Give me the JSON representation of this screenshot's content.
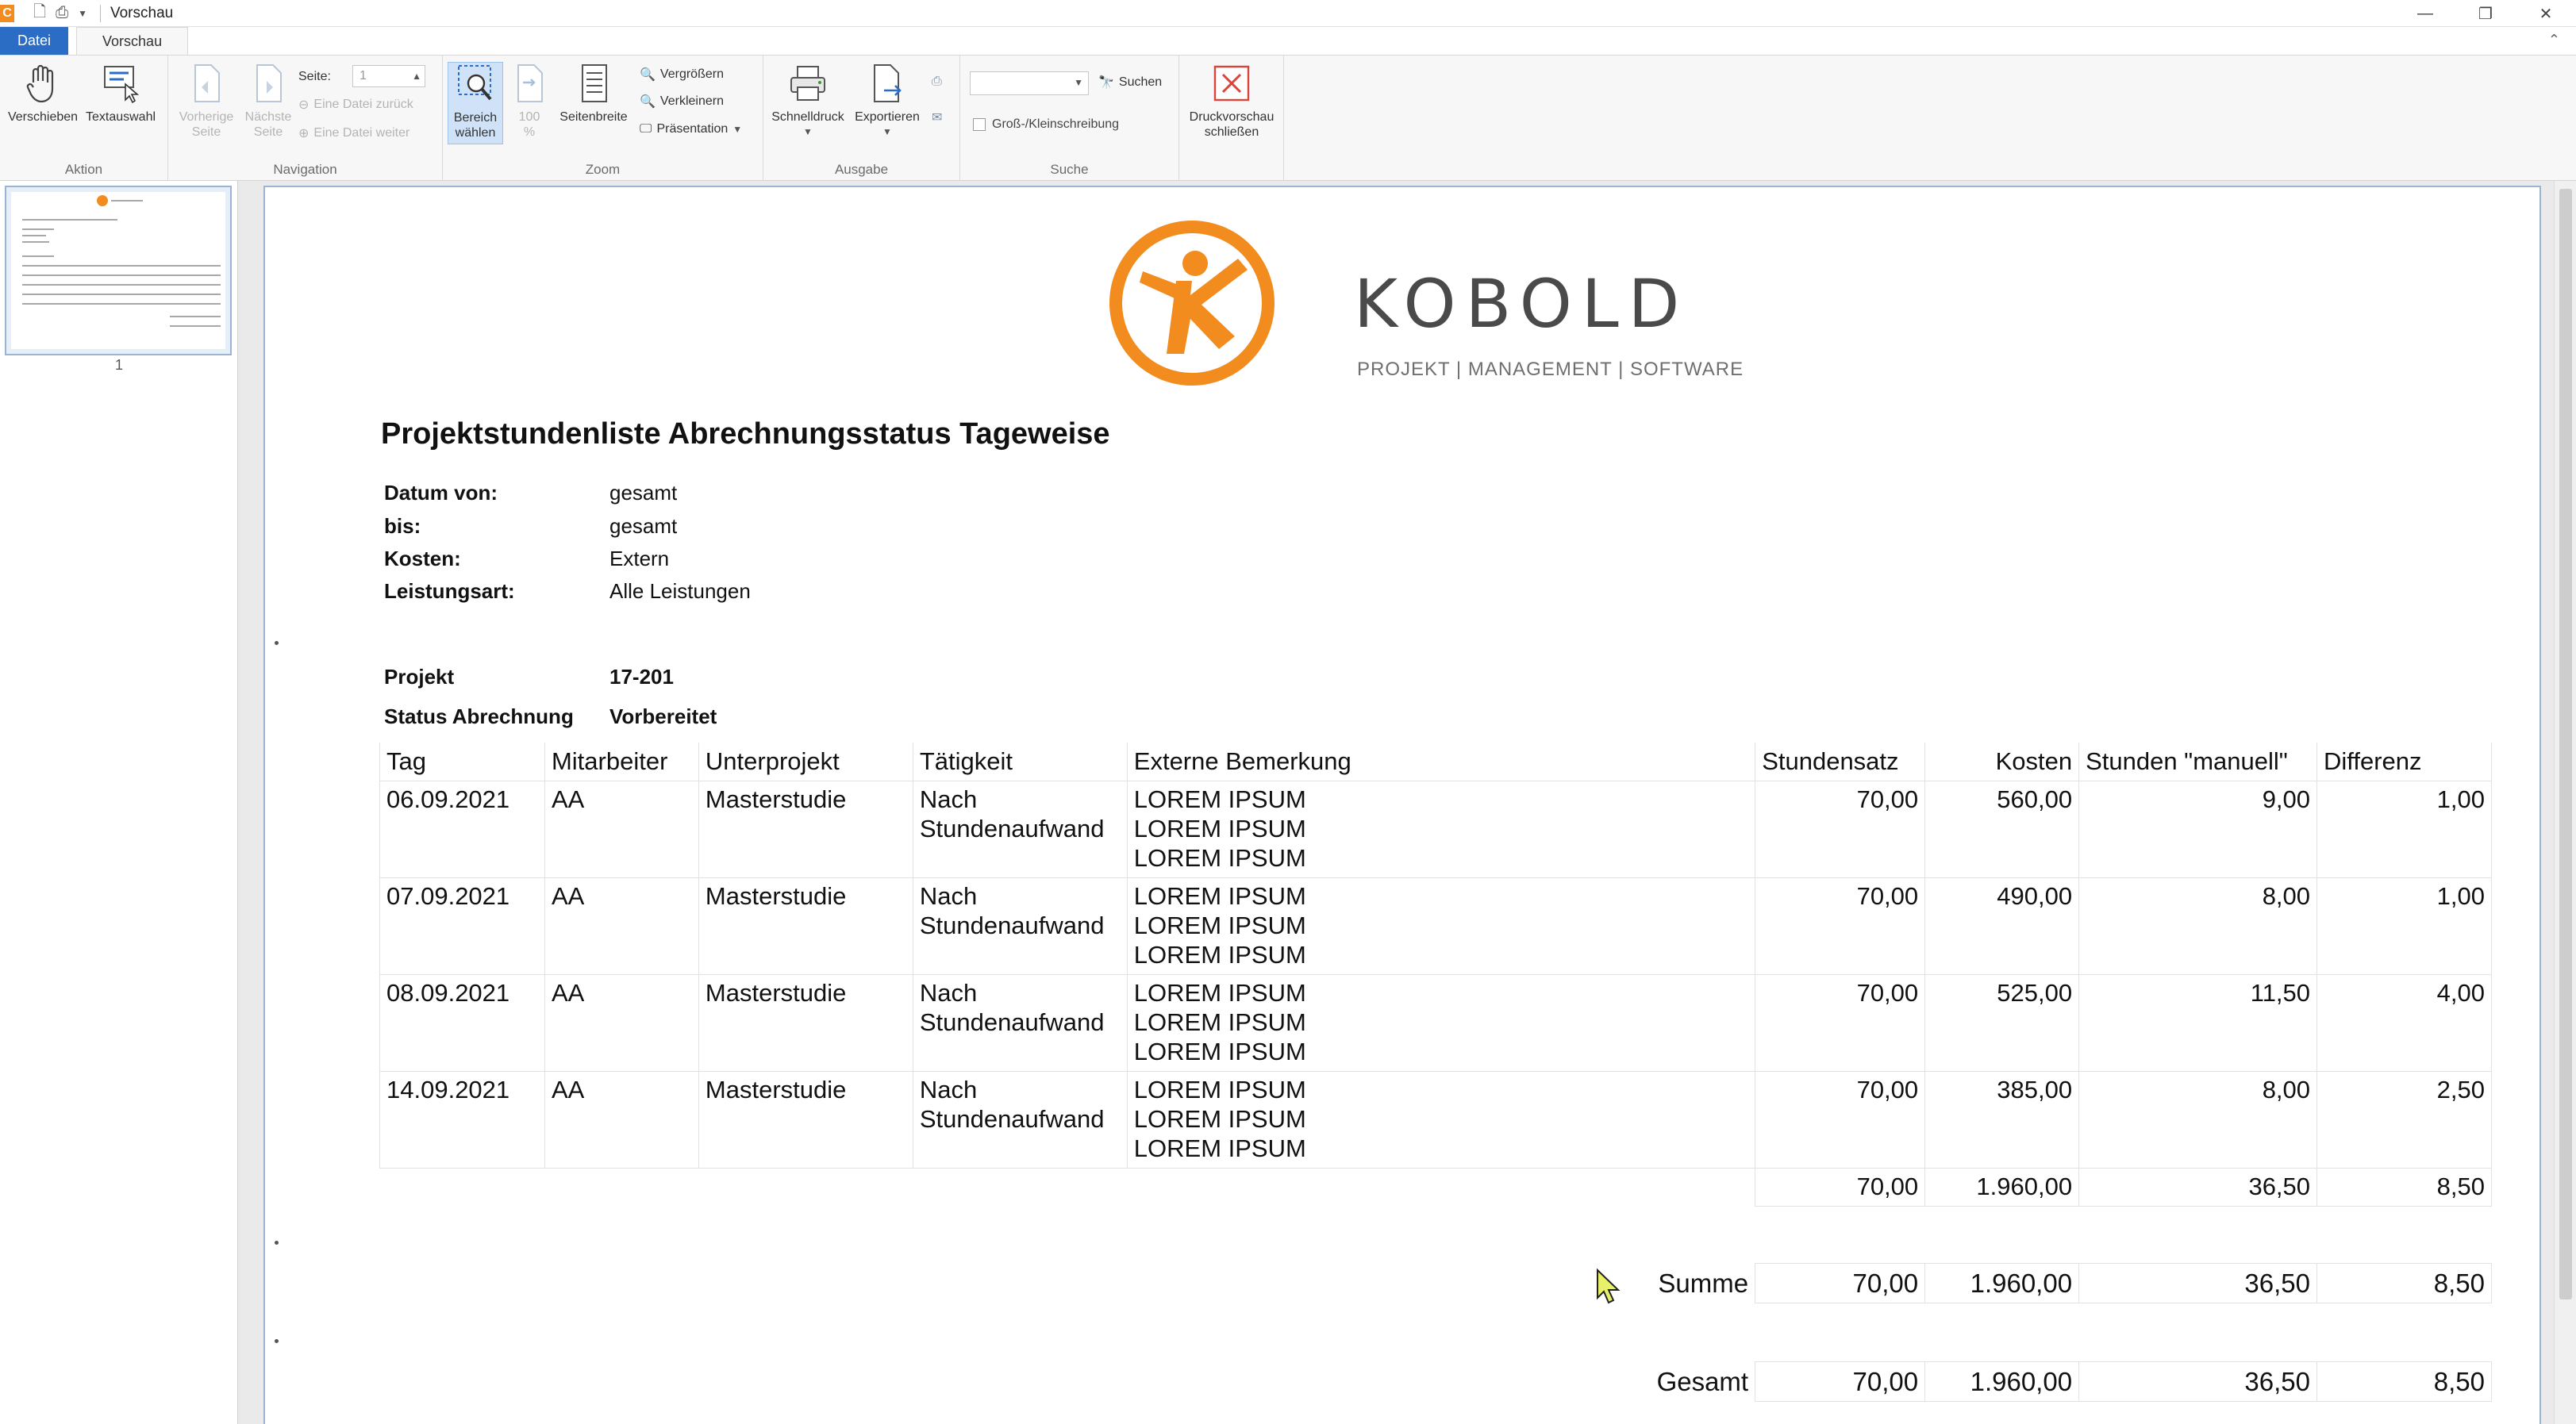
{
  "window": {
    "title": "Vorschau"
  },
  "tabs": {
    "file": "Datei",
    "preview": "Vorschau"
  },
  "ribbon": {
    "aktion": {
      "label": "Aktion",
      "move": "Verschieben",
      "textselect": "Textauswahl"
    },
    "navigation": {
      "label": "Navigation",
      "prev_1": "Vorherige",
      "prev_2": "Seite",
      "next_1": "Nächste",
      "next_2": "Seite",
      "page_label": "Seite:",
      "page_value": "1",
      "file_back": "Eine Datei zurück",
      "file_forward": "Eine Datei weiter"
    },
    "zoom": {
      "label": "Zoom",
      "area_1": "Bereich",
      "area_2": "wählen",
      "pct_1": "100",
      "pct_2": "%",
      "pagewidth": "Seitenbreite",
      "enlarge": "Vergrößern",
      "shrink": "Verkleinern",
      "presentation": "Präsentation"
    },
    "ausgabe": {
      "label": "Ausgabe",
      "quickprint": "Schnelldruck",
      "export": "Exportieren"
    },
    "suche": {
      "label": "Suche",
      "search": "Suchen",
      "casesensitive": "Groß-/Kleinschreibung"
    },
    "close": {
      "line1": "Druckvorschau",
      "line2": "schließen"
    }
  },
  "thumbnails": {
    "page_number": "1"
  },
  "report": {
    "logo": {
      "word": "KOBOLD",
      "tagline": "PROJEKT | MANAGEMENT | SOFTWARE"
    },
    "title": "Projektstundenliste Abrechnungsstatus Tageweise",
    "meta": [
      {
        "label": "Datum von:",
        "value": "gesamt"
      },
      {
        "label": "bis:",
        "value": "gesamt"
      },
      {
        "label": "Kosten:",
        "value": "Extern"
      },
      {
        "label": "Leistungsart:",
        "value": "Alle Leistungen"
      }
    ],
    "project": {
      "label": "Projekt",
      "value": "17-201"
    },
    "status": {
      "label": "Status Abrechnung",
      "value": "Vorbereitet"
    },
    "columns": [
      "Tag",
      "Mitarbeiter",
      "Unterprojekt",
      "Tätigkeit",
      "Externe Bemerkung",
      "Stundensatz",
      "Kosten",
      "Stunden \"manuell\"",
      "Differenz"
    ],
    "rows": [
      {
        "tag": "06.09.2021",
        "mitarbeiter": "AA",
        "unterprojekt": "Masterstudie",
        "taetigkeit_1": "Nach",
        "taetigkeit_2": "Stundenaufwand",
        "bemerkung_1": "LOREM IPSUM",
        "bemerkung_2": "LOREM IPSUM",
        "bemerkung_3": "LOREM IPSUM",
        "stundensatz": "70,00",
        "kosten": "560,00",
        "stunden": "9,00",
        "differenz": "1,00"
      },
      {
        "tag": "07.09.2021",
        "mitarbeiter": "AA",
        "unterprojekt": "Masterstudie",
        "taetigkeit_1": "Nach",
        "taetigkeit_2": "Stundenaufwand",
        "bemerkung_1": "LOREM IPSUM",
        "bemerkung_2": "LOREM IPSUM",
        "bemerkung_3": "LOREM IPSUM",
        "stundensatz": "70,00",
        "kosten": "490,00",
        "stunden": "8,00",
        "differenz": "1,00"
      },
      {
        "tag": "08.09.2021",
        "mitarbeiter": "AA",
        "unterprojekt": "Masterstudie",
        "taetigkeit_1": "Nach",
        "taetigkeit_2": "Stundenaufwand",
        "bemerkung_1": "LOREM IPSUM",
        "bemerkung_2": "LOREM IPSUM",
        "bemerkung_3": "LOREM IPSUM",
        "stundensatz": "70,00",
        "kosten": "525,00",
        "stunden": "11,50",
        "differenz": "4,00"
      },
      {
        "tag": "14.09.2021",
        "mitarbeiter": "AA",
        "unterprojekt": "Masterstudie",
        "taetigkeit_1": "Nach",
        "taetigkeit_2": "Stundenaufwand",
        "bemerkung_1": "LOREM IPSUM",
        "bemerkung_2": "LOREM IPSUM",
        "bemerkung_3": "LOREM IPSUM",
        "stundensatz": "70,00",
        "kosten": "385,00",
        "stunden": "8,00",
        "differenz": "2,50"
      }
    ],
    "project_total": {
      "stundensatz": "70,00",
      "kosten": "1.960,00",
      "stunden": "36,50",
      "differenz": "8,50"
    },
    "summe": {
      "label": "Summe",
      "stundensatz": "70,00",
      "kosten": "1.960,00",
      "stunden": "36,50",
      "differenz": "8,50"
    },
    "gesamt": {
      "label": "Gesamt",
      "stundensatz": "70,00",
      "kosten": "1.960,00",
      "stunden": "36,50",
      "differenz": "8,50"
    }
  },
  "colors": {
    "accent_blue": "#2b6cc4",
    "logo_orange": "#f28c1e",
    "close_red": "#d9443b"
  }
}
